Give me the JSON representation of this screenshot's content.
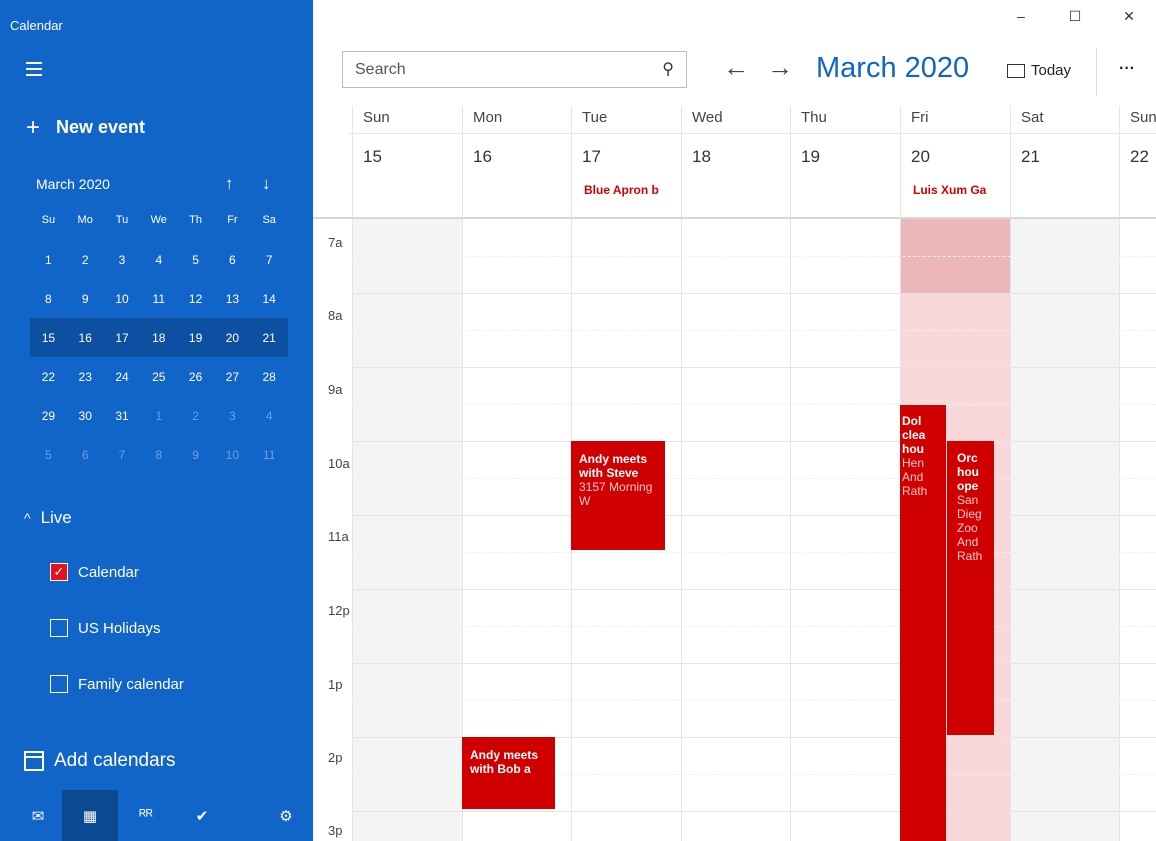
{
  "app": {
    "title": "Calendar"
  },
  "sidebar": {
    "new_event_label": "New event",
    "mini_calendar": {
      "month_label": "March 2020",
      "weekdays": [
        "Su",
        "Mo",
        "Tu",
        "We",
        "Th",
        "Fr",
        "Sa"
      ],
      "weeks": [
        [
          "1",
          "2",
          "3",
          "4",
          "5",
          "6",
          "7"
        ],
        [
          "8",
          "9",
          "10",
          "11",
          "12",
          "13",
          "14"
        ],
        [
          "15",
          "16",
          "17",
          "18",
          "19",
          "20",
          "21"
        ],
        [
          "22",
          "23",
          "24",
          "25",
          "26",
          "27",
          "28"
        ],
        [
          "29",
          "30",
          "31",
          "1",
          "2",
          "3",
          "4"
        ],
        [
          "5",
          "6",
          "7",
          "8",
          "9",
          "10",
          "11"
        ]
      ]
    },
    "account_label": "Live",
    "calendars": [
      {
        "label": "Calendar",
        "checked": true
      },
      {
        "label": "US Holidays",
        "checked": false
      },
      {
        "label": "Family calendar",
        "checked": false
      }
    ],
    "add_calendars_label": "Add calendars"
  },
  "toolbar": {
    "search_placeholder": "Search",
    "title": "March 2020",
    "today_label": "Today",
    "more_label": "···"
  },
  "days": [
    {
      "dow": "Sun",
      "date": "15",
      "allday": ""
    },
    {
      "dow": "Mon",
      "date": "16",
      "allday": ""
    },
    {
      "dow": "Tue",
      "date": "17",
      "allday": "Blue Apron b"
    },
    {
      "dow": "Wed",
      "date": "18",
      "allday": ""
    },
    {
      "dow": "Thu",
      "date": "19",
      "allday": ""
    },
    {
      "dow": "Fri",
      "date": "20",
      "allday": "Luis Xum Ga"
    },
    {
      "dow": "Sat",
      "date": "21",
      "allday": ""
    },
    {
      "dow": "Sun",
      "date": "22",
      "allday": ""
    }
  ],
  "hours": [
    "7a",
    "8a",
    "9a",
    "10a",
    "11a",
    "12p",
    "1p",
    "2p",
    "3p"
  ],
  "events": [
    {
      "title": "Andy meets with Steve",
      "location": "3157 Morning W"
    },
    {
      "title": "Andy meets with Bob a",
      "location": ""
    },
    {
      "title": "Dol clea hou",
      "location": "Hen And Rath"
    },
    {
      "title": "Orc hou ope",
      "location": "San Dieg Zoo And Rath"
    }
  ],
  "colors": {
    "sidebar": "#1164c8",
    "accent": "#1164c8",
    "event": "#d00000"
  }
}
